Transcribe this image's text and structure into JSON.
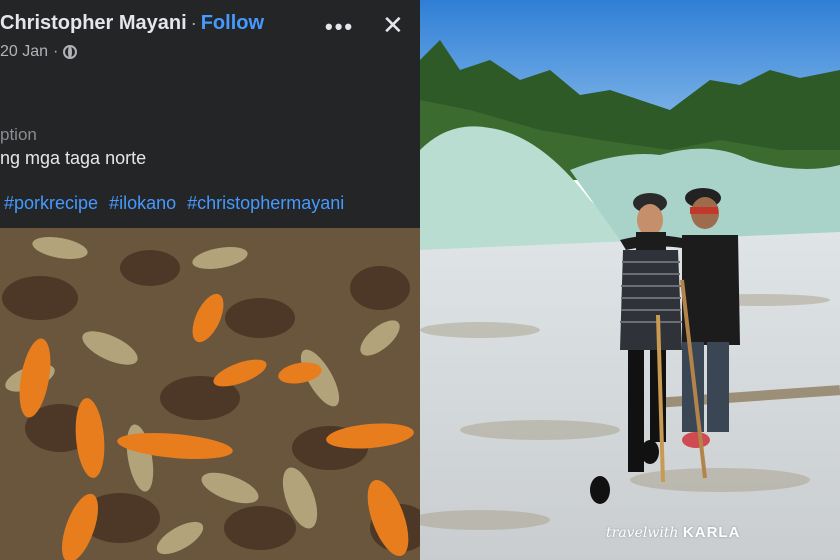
{
  "post": {
    "author": "Christopher Mayani",
    "separator": "·",
    "follow_label": "Follow",
    "more_label": "•••",
    "close_label": "✕",
    "date": "20 Jan",
    "date_separator": "·",
    "caption_label": "ption",
    "caption_text": "ng mga taga norte",
    "hashtags": [
      "#porkrecipe",
      "#ilokano",
      "#christophermayani"
    ]
  },
  "photo": {
    "watermark_script": "travelwith",
    "watermark_brand": "KARLA"
  },
  "colors": {
    "header_bg": "#242526",
    "link_blue": "#4599ff",
    "text_primary": "#e4e6eb",
    "text_secondary": "#b0b3b8"
  }
}
